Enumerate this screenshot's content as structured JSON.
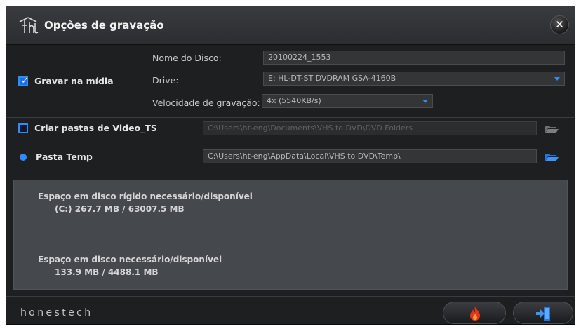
{
  "window": {
    "title": "Opções de gravação",
    "close_label": "✕"
  },
  "burn_section": {
    "checkbox_label": "Gravar na mídia",
    "checked": true,
    "disc_name_label": "Nome do Disco:",
    "disc_name_value": "20100224_1553",
    "drive_label": "Drive:",
    "drive_value": "E: HL-DT-ST DVDRAM GSA-4160B",
    "speed_label": "Velocidade de gravação:",
    "speed_value": "4x (5540KB/s)"
  },
  "video_ts_section": {
    "checkbox_label": "Criar pastas de Video_TS",
    "checked": false,
    "path_value": "C:\\Users\\ht-eng\\Documents\\VHS to DVD\\DVD Folders"
  },
  "temp_section": {
    "radio_label": "Pasta Temp",
    "path_value": "C:\\Users\\ht-eng\\AppData\\Local\\VHS to DVD\\Temp\\"
  },
  "info": {
    "hdd_label": "Espaço em disco rígido necessário/disponível",
    "hdd_value": "(C:)  267.7 MB / 63007.5 MB",
    "disc_label": "Espaço em disco necessário/disponível",
    "disc_value": "133.9 MB / 4488.1 MB"
  },
  "footer": {
    "brand": "honestech"
  },
  "colors": {
    "accent": "#2d8cff",
    "panel": "#45484c",
    "background": "#1e1f21",
    "burn_flame": "#e5331a"
  },
  "icons": [
    "honestech-logo-icon",
    "close-icon",
    "folder-open-icon",
    "burn-icon",
    "exit-icon"
  ]
}
